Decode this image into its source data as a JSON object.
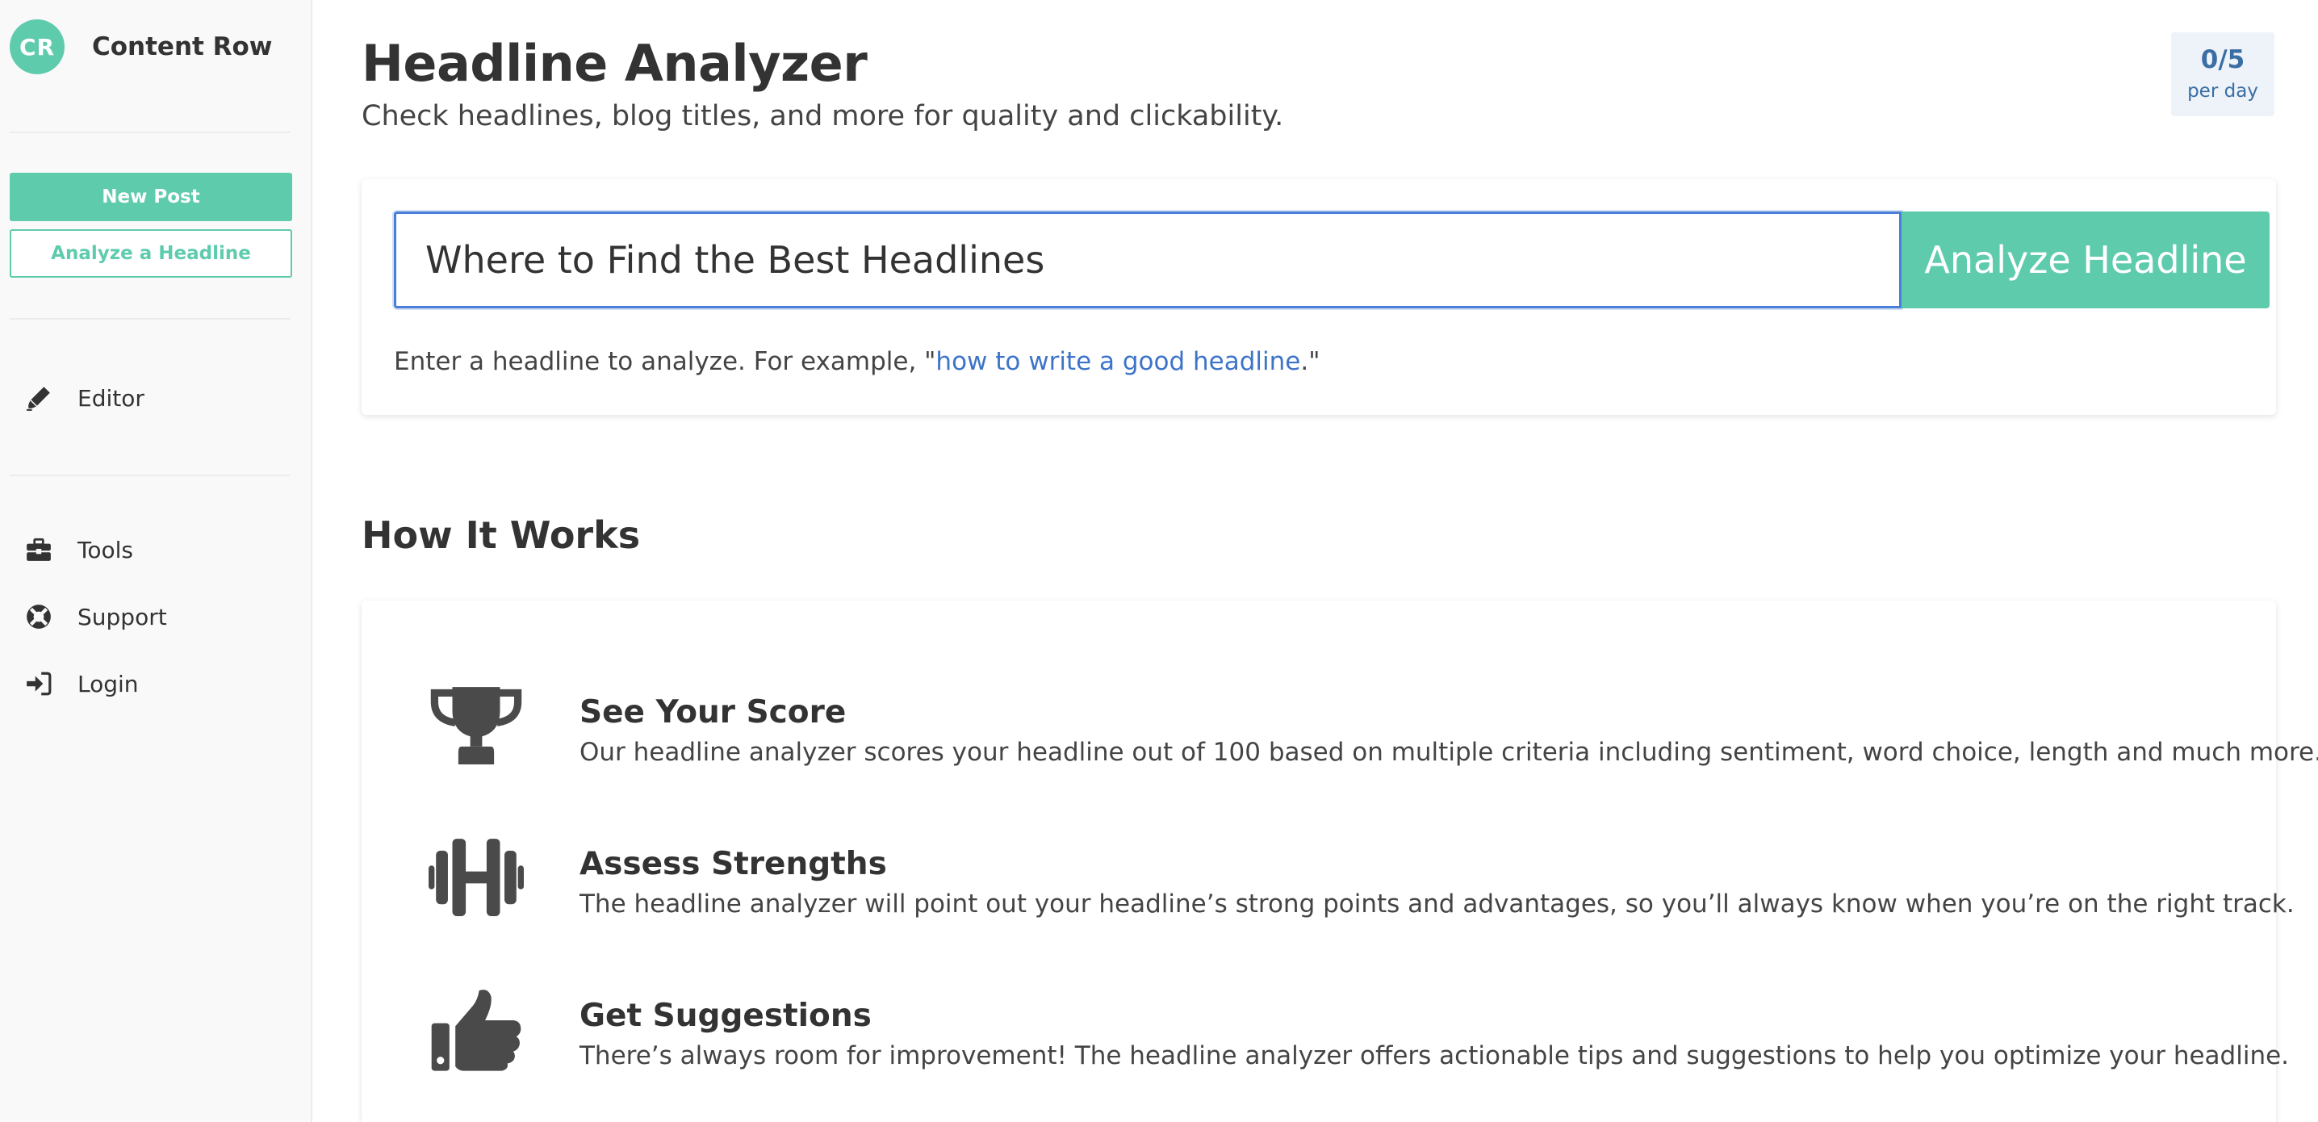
{
  "brand": {
    "initials": "CR",
    "name": "Content Row",
    "color": "#5fcbad"
  },
  "sidebar": {
    "new_post_label": "New Post",
    "analyze_label": "Analyze a Headline",
    "items": [
      {
        "label": "Editor",
        "icon": "pencil-icon"
      },
      {
        "label": "Tools",
        "icon": "toolbox-icon"
      },
      {
        "label": "Support",
        "icon": "lifebuoy-icon"
      },
      {
        "label": "Login",
        "icon": "sign-in-icon"
      }
    ]
  },
  "header": {
    "title": "Headline Analyzer",
    "subtitle": "Check headlines, blog titles, and more for quality and clickability.",
    "quota": {
      "count": "0/5",
      "label": "per day"
    }
  },
  "search": {
    "value": "Where to Find the Best Headlines",
    "button_label": "Analyze Headline",
    "hint_prefix": "Enter a headline to analyze. For example, \"",
    "hint_link": "how to write a good headline",
    "hint_suffix": ".\""
  },
  "how_it_works": {
    "title": "How It Works",
    "features": [
      {
        "icon": "trophy-icon",
        "title": "See Your Score",
        "description": "Our headline analyzer scores your headline out of 100 based on multiple criteria including sentiment, word choice, length and much more."
      },
      {
        "icon": "dumbbell-icon",
        "title": "Assess Strengths",
        "description": "The headline analyzer will point out your headline’s strong points and advantages, so you’ll always know when you’re on the right track."
      },
      {
        "icon": "thumbs-up-icon",
        "title": "Get Suggestions",
        "description": "There’s always room for improvement! The headline analyzer offers actionable tips and suggestions to help you optimize your headline."
      }
    ]
  },
  "colors": {
    "accent": "#5fcbad",
    "link": "#3d74c9",
    "icon": "#4a4a4a",
    "sidebar_bg": "#f9f9f9"
  }
}
